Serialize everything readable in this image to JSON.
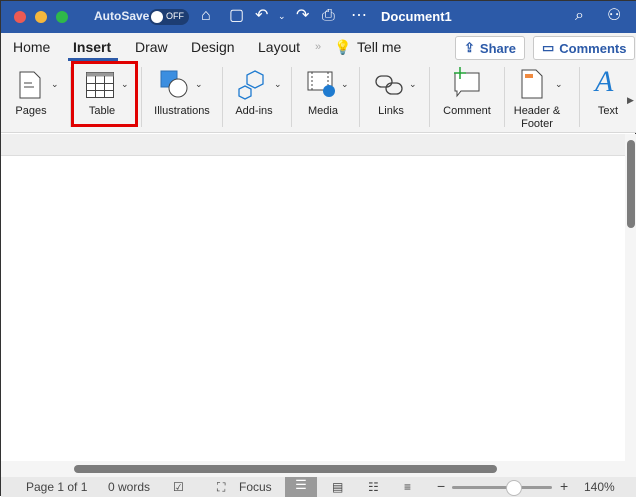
{
  "titlebar": {
    "autosave_label": "AutoSave",
    "autosave_state": "OFF",
    "document_title": "Document1"
  },
  "tabs": [
    {
      "label": "Home"
    },
    {
      "label": "Insert",
      "active": true
    },
    {
      "label": "Draw"
    },
    {
      "label": "Design"
    },
    {
      "label": "Layout"
    }
  ],
  "tell_me": "Tell me",
  "share_label": "Share",
  "comments_label": "Comments",
  "ribbon": [
    {
      "label": "Pages"
    },
    {
      "label": "Table",
      "highlighted": true
    },
    {
      "label": "Illustrations"
    },
    {
      "label": "Add-ins"
    },
    {
      "label": "Media"
    },
    {
      "label": "Links"
    },
    {
      "label": "Comment"
    },
    {
      "label": "Header &",
      "label2": "Footer"
    },
    {
      "label": "Text"
    }
  ],
  "status": {
    "page": "Page 1 of 1",
    "words": "0 words",
    "focus": "Focus",
    "zoom_minus": "−",
    "zoom_plus": "+",
    "zoom": "140%",
    "zoom_fraction": 0.62
  },
  "colors": {
    "titlebar": "#2c5aa8",
    "highlight": "#e00000",
    "accent": "#1f7bd0"
  }
}
